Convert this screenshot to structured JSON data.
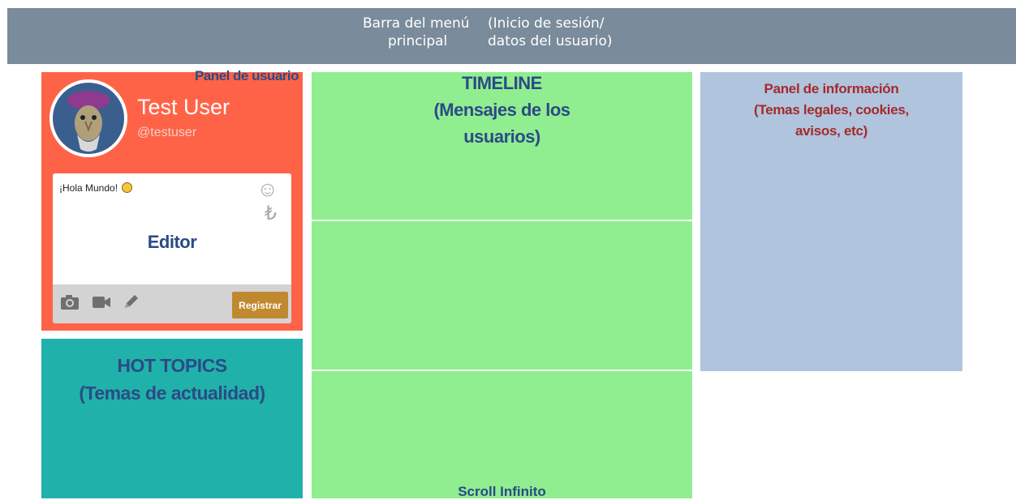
{
  "topbar": {
    "menu_line1": "Barra del menú",
    "menu_line2": "principal",
    "session_line1": "(Inicio de sesión/",
    "session_line2": "datos del usuario)"
  },
  "user_panel": {
    "title": "Panel de usuario",
    "name": "Test User",
    "handle": "@testuser",
    "editor": {
      "text": "¡Hola Mundo!",
      "label": "Editor",
      "register_label": "Registrar",
      "icons": [
        "smiley-icon",
        "currency-icon",
        "camera-icon",
        "video-icon",
        "pencil-icon"
      ]
    }
  },
  "hot_topics": {
    "line1": "HOT TOPICS",
    "line2": "(Temas de actualidad)"
  },
  "timeline": {
    "line1": "TIMELINE",
    "line2": "(Mensajes de los",
    "line3": "usuarios)",
    "scroll_label": "Scroll Infinito"
  },
  "info_panel": {
    "line1": "Panel de información",
    "line2": "(Temas legales, cookies,",
    "line3": "avisos, etc)"
  },
  "colors": {
    "topbar": "#7a8b9b",
    "user_panel": "#ff6347",
    "hot_topics": "#20b2aa",
    "timeline": "#90ee90",
    "info_panel": "#b0c4de",
    "register_button": "#c0892f"
  }
}
